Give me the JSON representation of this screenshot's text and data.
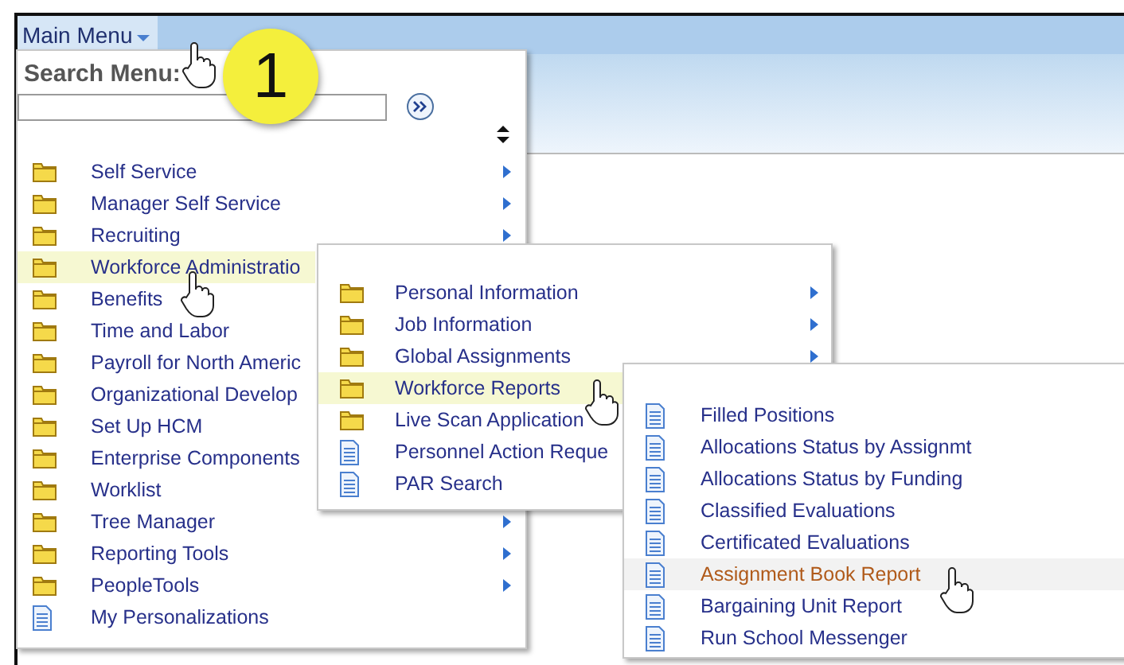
{
  "menu_bar": {
    "title": "Main Menu"
  },
  "callout": {
    "label": "1"
  },
  "search": {
    "label": "Search Menu:"
  },
  "main_menu": [
    {
      "label": "Self Service",
      "kind": "folder",
      "arrow": true,
      "selected": false
    },
    {
      "label": "Manager Self Service",
      "kind": "folder",
      "arrow": true,
      "selected": false
    },
    {
      "label": "Recruiting",
      "kind": "folder",
      "arrow": true,
      "selected": false
    },
    {
      "label": "Workforce Administratio",
      "kind": "folder",
      "arrow": false,
      "selected": true
    },
    {
      "label": "Benefits",
      "kind": "folder",
      "arrow": false,
      "selected": false
    },
    {
      "label": "Time and Labor",
      "kind": "folder",
      "arrow": false,
      "selected": false
    },
    {
      "label": "Payroll for North Americ",
      "kind": "folder",
      "arrow": false,
      "selected": false
    },
    {
      "label": "Organizational Develop",
      "kind": "folder",
      "arrow": false,
      "selected": false
    },
    {
      "label": "Set Up HCM",
      "kind": "folder",
      "arrow": false,
      "selected": false
    },
    {
      "label": "Enterprise Components",
      "kind": "folder",
      "arrow": false,
      "selected": false
    },
    {
      "label": "Worklist",
      "kind": "folder",
      "arrow": false,
      "selected": false
    },
    {
      "label": "Tree Manager",
      "kind": "folder",
      "arrow": true,
      "selected": false
    },
    {
      "label": "Reporting Tools",
      "kind": "folder",
      "arrow": true,
      "selected": false
    },
    {
      "label": "PeopleTools",
      "kind": "folder",
      "arrow": true,
      "selected": false
    },
    {
      "label": "My Personalizations",
      "kind": "page",
      "arrow": false,
      "selected": false
    }
  ],
  "submenu": [
    {
      "label": "Personal Information",
      "kind": "folder",
      "arrow": true,
      "selected": false
    },
    {
      "label": "Job Information",
      "kind": "folder",
      "arrow": true,
      "selected": false
    },
    {
      "label": "Global Assignments",
      "kind": "folder",
      "arrow": true,
      "selected": false
    },
    {
      "label": "Workforce Reports",
      "kind": "folder",
      "arrow": false,
      "selected": true
    },
    {
      "label": "Live Scan Application",
      "kind": "folder",
      "arrow": false,
      "selected": false
    },
    {
      "label": "Personnel Action Reque",
      "kind": "page",
      "arrow": false,
      "selected": false
    },
    {
      "label": "PAR Search",
      "kind": "page",
      "arrow": false,
      "selected": false
    }
  ],
  "reports_menu": [
    {
      "label": "Filled Positions",
      "kind": "page",
      "arrow": false,
      "selected": false
    },
    {
      "label": "Allocations Status by Assignmt",
      "kind": "page",
      "arrow": false,
      "selected": false
    },
    {
      "label": "Allocations Status by Funding",
      "kind": "page",
      "arrow": false,
      "selected": false
    },
    {
      "label": "Classified Evaluations",
      "kind": "page",
      "arrow": false,
      "selected": false
    },
    {
      "label": "Certificated Evaluations",
      "kind": "page",
      "arrow": false,
      "selected": false
    },
    {
      "label": "Assignment Book Report",
      "kind": "page",
      "arrow": false,
      "selected": true
    },
    {
      "label": "Bargaining Unit Report",
      "kind": "page",
      "arrow": false,
      "selected": false
    },
    {
      "label": "Run School Messenger",
      "kind": "page",
      "arrow": false,
      "selected": false
    }
  ]
}
